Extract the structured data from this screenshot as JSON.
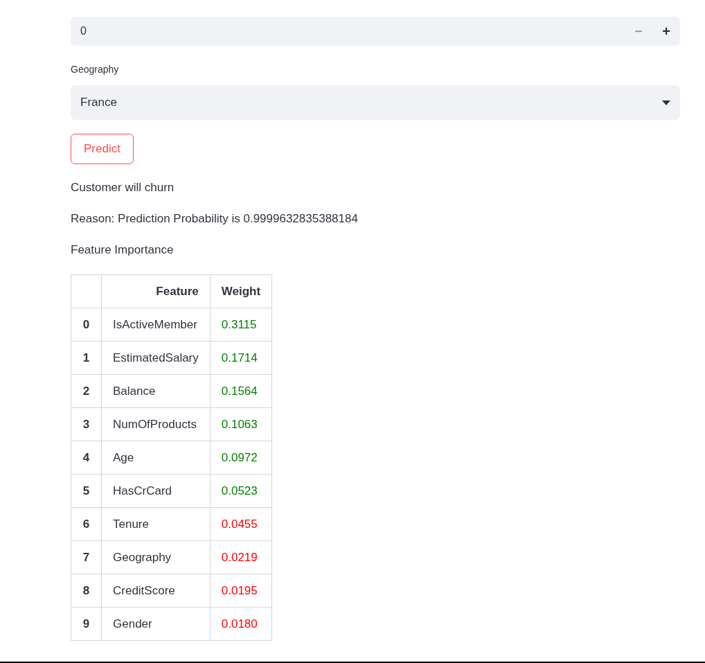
{
  "number_input": {
    "value": "0",
    "steppers": [
      {
        "label": "−",
        "disabled": true
      },
      {
        "label": "+",
        "disabled": false
      }
    ]
  },
  "select": {
    "label": "Geography",
    "value": "France"
  },
  "button": {
    "label": "Predict"
  },
  "messages": [
    "Customer will churn",
    "Reason: Prediction Probability is 0.9999632835388184",
    "Feature Importance"
  ],
  "table": {
    "columns": [
      "Feature",
      "Weight"
    ],
    "rows": [
      {
        "index": "0",
        "feature": "IsActiveMember",
        "weight": "0.3115",
        "color": "#008000"
      },
      {
        "index": "1",
        "feature": "EstimatedSalary",
        "weight": "0.1714",
        "color": "#008000"
      },
      {
        "index": "2",
        "feature": "Balance",
        "weight": "0.1564",
        "color": "#008000"
      },
      {
        "index": "3",
        "feature": "NumOfProducts",
        "weight": "0.1063",
        "color": "#008000"
      },
      {
        "index": "4",
        "feature": "Age",
        "weight": "0.0972",
        "color": "#008000"
      },
      {
        "index": "5",
        "feature": "HasCrCard",
        "weight": "0.0523",
        "color": "#008000"
      },
      {
        "index": "6",
        "feature": "Tenure",
        "weight": "0.0455",
        "color": "#ff0000"
      },
      {
        "index": "7",
        "feature": "Geography",
        "weight": "0.0219",
        "color": "#ff0000"
      },
      {
        "index": "8",
        "feature": "CreditScore",
        "weight": "0.0195",
        "color": "#ff0000"
      },
      {
        "index": "9",
        "feature": "Gender",
        "weight": "0.0180",
        "color": "#ff0000"
      }
    ]
  }
}
